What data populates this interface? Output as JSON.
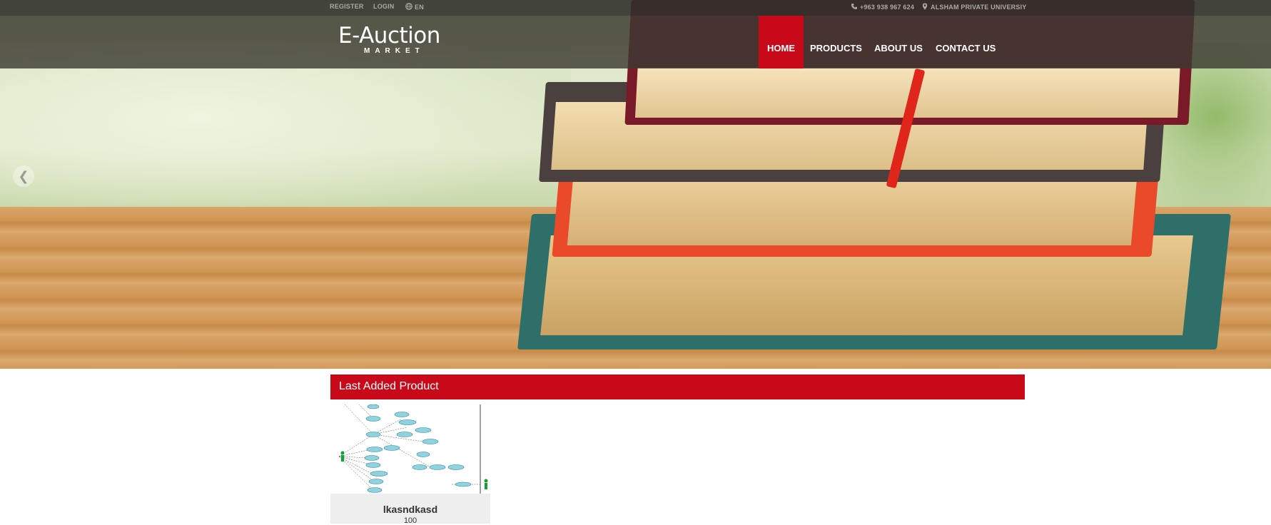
{
  "topbar": {
    "register": "REGISTER",
    "login": "LOGIN",
    "language": "EN",
    "phone": "+963 938 967 624",
    "location": "ALSHAM PRIVATE UNIVERSIY",
    "icons": [
      "globe-icon",
      "phone-icon",
      "map-pin-icon"
    ]
  },
  "logo": {
    "main": "E-Auction",
    "sub": "MARKET"
  },
  "nav": {
    "items": [
      {
        "label": "HOME",
        "active": true
      },
      {
        "label": "PRODUCTS",
        "active": false
      },
      {
        "label": "ABOUT US",
        "active": false
      },
      {
        "label": "CONTACT US",
        "active": false
      }
    ]
  },
  "slider": {
    "prev_icon": "chevron-left-icon"
  },
  "section": {
    "title": "Last Added Product"
  },
  "products": [
    {
      "name": "lkasndkasd",
      "price": "100"
    }
  ],
  "colors": {
    "accent": "#c8091a",
    "topbar": "#30302c",
    "card_bg": "#eeeeee"
  }
}
